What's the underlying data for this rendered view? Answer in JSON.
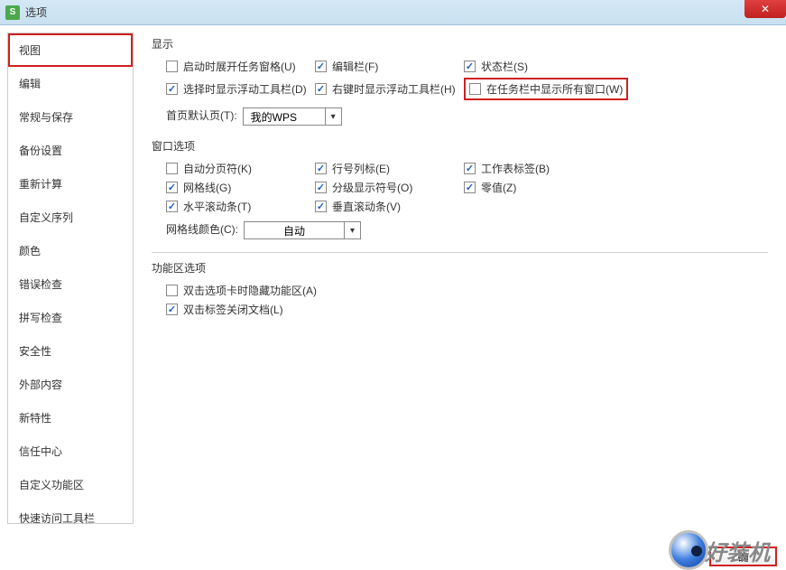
{
  "titlebar": {
    "title": "选项",
    "icon_letter": "S"
  },
  "sidebar": {
    "items": [
      {
        "label": "视图",
        "active": true
      },
      {
        "label": "编辑"
      },
      {
        "label": "常规与保存"
      },
      {
        "label": "备份设置"
      },
      {
        "label": "重新计算"
      },
      {
        "label": "自定义序列"
      },
      {
        "label": "颜色"
      },
      {
        "label": "错误检查"
      },
      {
        "label": "拼写检查"
      },
      {
        "label": "安全性"
      },
      {
        "label": "外部内容"
      },
      {
        "label": "新特性"
      },
      {
        "label": "信任中心"
      },
      {
        "label": "自定义功能区"
      },
      {
        "label": "快速访问工具栏"
      }
    ]
  },
  "display": {
    "title": "显示",
    "startup_pane": {
      "label": "启动时展开任务窗格(U)",
      "checked": false
    },
    "edit_bar": {
      "label": "编辑栏(F)",
      "checked": true
    },
    "status_bar": {
      "label": "状态栏(S)",
      "checked": true
    },
    "float_select": {
      "label": "选择时显示浮动工具栏(D)",
      "checked": true
    },
    "float_right": {
      "label": "右键时显示浮动工具栏(H)",
      "checked": true
    },
    "taskbar_all": {
      "label": "在任务栏中显示所有窗口(W)",
      "checked": false
    },
    "default_tab_label": "首页默认页(T):",
    "default_tab_value": "我的WPS"
  },
  "window_opts": {
    "title": "窗口选项",
    "auto_pagebreak": {
      "label": "自动分页符(K)",
      "checked": false
    },
    "rowcol_header": {
      "label": "行号列标(E)",
      "checked": true
    },
    "sheet_tabs": {
      "label": "工作表标签(B)",
      "checked": true
    },
    "gridlines": {
      "label": "网格线(G)",
      "checked": true
    },
    "outline_symbols": {
      "label": "分级显示符号(O)",
      "checked": true
    },
    "zero_values": {
      "label": "零值(Z)",
      "checked": true
    },
    "hscroll": {
      "label": "水平滚动条(T)",
      "checked": true
    },
    "vscroll": {
      "label": "垂直滚动条(V)",
      "checked": true
    },
    "grid_color_label": "网格线颜色(C):",
    "grid_color_value": "自动"
  },
  "ribbon_opts": {
    "title": "功能区选项",
    "dblclick_hide": {
      "label": "双击选项卡时隐藏功能区(A)",
      "checked": false
    },
    "dblclick_close": {
      "label": "双击标签关闭文档(L)",
      "checked": true
    }
  },
  "footer": {
    "ok": "确",
    "watermark": "好装机"
  }
}
